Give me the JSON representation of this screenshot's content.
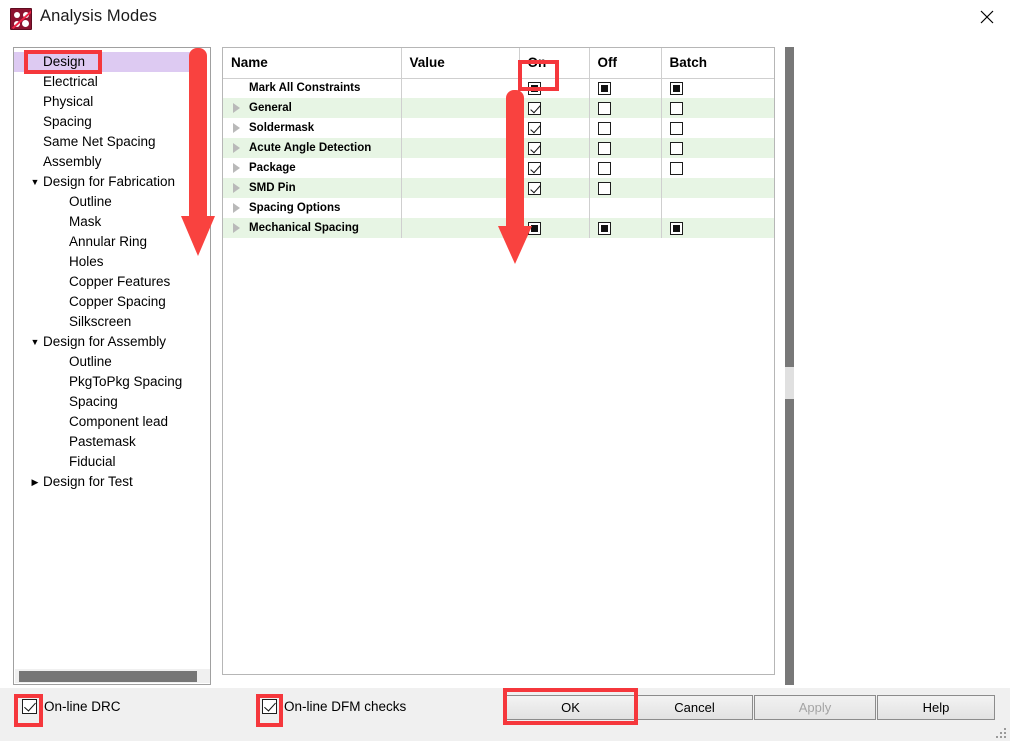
{
  "window": {
    "title": "Analysis Modes",
    "app_icon": "analysis-modes-icon",
    "close_icon": "close-icon"
  },
  "tree": {
    "items": [
      {
        "label": "Design",
        "level": 0,
        "twisty": "",
        "selected": true
      },
      {
        "label": "Electrical",
        "level": 0,
        "twisty": "",
        "selected": false
      },
      {
        "label": "Physical",
        "level": 0,
        "twisty": "",
        "selected": false
      },
      {
        "label": "Spacing",
        "level": 0,
        "twisty": "",
        "selected": false
      },
      {
        "label": "Same Net Spacing",
        "level": 0,
        "twisty": "",
        "selected": false
      },
      {
        "label": "Assembly",
        "level": 0,
        "twisty": "",
        "selected": false
      },
      {
        "label": "Design for Fabrication",
        "level": 0,
        "twisty": "▼",
        "selected": false
      },
      {
        "label": "Outline",
        "level": 1,
        "twisty": "",
        "selected": false
      },
      {
        "label": "Mask",
        "level": 1,
        "twisty": "",
        "selected": false
      },
      {
        "label": "Annular Ring",
        "level": 1,
        "twisty": "",
        "selected": false
      },
      {
        "label": "Holes",
        "level": 1,
        "twisty": "",
        "selected": false
      },
      {
        "label": "Copper Features",
        "level": 1,
        "twisty": "",
        "selected": false
      },
      {
        "label": "Copper Spacing",
        "level": 1,
        "twisty": "",
        "selected": false
      },
      {
        "label": "Silkscreen",
        "level": 1,
        "twisty": "",
        "selected": false
      },
      {
        "label": "Design for Assembly",
        "level": 0,
        "twisty": "▼",
        "selected": false
      },
      {
        "label": "Outline",
        "level": 1,
        "twisty": "",
        "selected": false
      },
      {
        "label": "PkgToPkg Spacing",
        "level": 1,
        "twisty": "",
        "selected": false
      },
      {
        "label": "Spacing",
        "level": 1,
        "twisty": "",
        "selected": false
      },
      {
        "label": "Component lead",
        "level": 1,
        "twisty": "",
        "selected": false
      },
      {
        "label": "Pastemask",
        "level": 1,
        "twisty": "",
        "selected": false
      },
      {
        "label": "Fiducial",
        "level": 1,
        "twisty": "",
        "selected": false
      },
      {
        "label": "Design for Test",
        "level": 0,
        "twisty": "▶",
        "selected": false
      }
    ],
    "selected_bg": "#ddcaf2"
  },
  "grid": {
    "columns": [
      "Name",
      "Value",
      "On",
      "Off",
      "Batch"
    ],
    "rows": [
      {
        "name": "Mark All Constraints",
        "expandable": false,
        "value": "",
        "on": "filled",
        "off": "filled",
        "batch": "filled",
        "alt": false
      },
      {
        "name": "General",
        "expandable": true,
        "value": "",
        "on": "checked",
        "off": "empty",
        "batch": "empty",
        "alt": true
      },
      {
        "name": "Soldermask",
        "expandable": true,
        "value": "",
        "on": "checked",
        "off": "empty",
        "batch": "empty",
        "alt": false
      },
      {
        "name": "Acute Angle Detection",
        "expandable": true,
        "value": "",
        "on": "checked",
        "off": "empty",
        "batch": "empty",
        "alt": true
      },
      {
        "name": "Package",
        "expandable": true,
        "value": "",
        "on": "checked",
        "off": "empty",
        "batch": "empty",
        "alt": false
      },
      {
        "name": "SMD Pin",
        "expandable": true,
        "value": "",
        "on": "checked",
        "off": "empty",
        "batch": "none",
        "alt": true
      },
      {
        "name": "Spacing Options",
        "expandable": true,
        "value": "",
        "on": "none",
        "off": "none",
        "batch": "none",
        "alt": false
      },
      {
        "name": "Mechanical Spacing",
        "expandable": true,
        "value": "",
        "on": "filled",
        "off": "filled",
        "batch": "filled",
        "alt": true
      }
    ],
    "alt_row_color": "#e7f5e4"
  },
  "footer": {
    "online_drc_label": "On-line DRC",
    "online_drc_checked": true,
    "online_dfm_label": "On-line DFM checks",
    "online_dfm_checked": true,
    "buttons": {
      "ok": "OK",
      "cancel": "Cancel",
      "apply": "Apply",
      "help": "Help"
    },
    "apply_disabled": true
  },
  "annotations": {
    "color": "#f5373c",
    "highlight_boxes": [
      "design-tree-item",
      "on-column-header",
      "online-drc-checkbox",
      "online-dfm-checkbox",
      "ok-button"
    ],
    "arrows": [
      "tree-scroll-down-arrow",
      "on-column-down-arrow"
    ]
  }
}
